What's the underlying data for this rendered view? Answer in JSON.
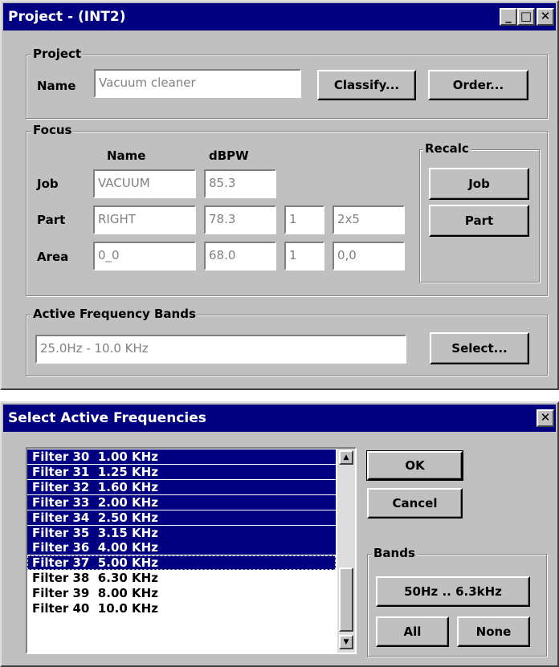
{
  "project_window": {
    "title": "Project - (INT2)",
    "controls": {
      "minimize": "_",
      "maximize": "□",
      "close": "✕"
    },
    "project_group": {
      "legend": "Project",
      "name_label": "Name",
      "name_value": "Vacuum cleaner",
      "classify_label": "Classify...",
      "order_label": "Order..."
    },
    "focus_group": {
      "legend": "Focus",
      "col_name": "Name",
      "col_dbpw": "dBPW",
      "rows": [
        {
          "label": "Job",
          "name": "VACUUM",
          "dbpw": "85.3"
        },
        {
          "label": "Part",
          "name": "RIGHT",
          "dbpw": "78.3",
          "count": "1",
          "size": "2x5"
        },
        {
          "label": "Area",
          "name": "0_0",
          "dbpw": "68.0",
          "count": "1",
          "size": "0,0"
        }
      ],
      "recalc": {
        "legend": "Recalc",
        "job_label": "Job",
        "part_label": "Part"
      }
    },
    "bands_group": {
      "legend": "Active Frequency Bands",
      "range_value": "25.0Hz - 10.0 KHz",
      "select_label": "Select..."
    }
  },
  "select_window": {
    "title": "Select Active Frequencies",
    "close": "✕",
    "filters": [
      {
        "text": "Filter 30  1.00 KHz",
        "selected": true
      },
      {
        "text": "Filter 31  1.25 KHz",
        "selected": true
      },
      {
        "text": "Filter 32  1.60 KHz",
        "selected": true
      },
      {
        "text": "Filter 33  2.00 KHz",
        "selected": true
      },
      {
        "text": "Filter 34  2.50 KHz",
        "selected": true
      },
      {
        "text": "Filter 35  3.15 KHz",
        "selected": true
      },
      {
        "text": "Filter 36  4.00 KHz",
        "selected": true
      },
      {
        "text": "Filter 37  5.00 KHz",
        "selected": true,
        "focused": true
      },
      {
        "text": "Filter 38  6.30 KHz",
        "selected": false
      },
      {
        "text": "Filter 39  8.00 KHz",
        "selected": false
      },
      {
        "text": "Filter 40  10.0 KHz",
        "selected": false
      }
    ],
    "scroll_up": "▲",
    "scroll_down": "▼",
    "ok_label": "OK",
    "cancel_label": "Cancel",
    "bands": {
      "legend": "Bands",
      "preset_label": "50Hz .. 6.3kHz",
      "all_label": "All",
      "none_label": "None"
    }
  }
}
